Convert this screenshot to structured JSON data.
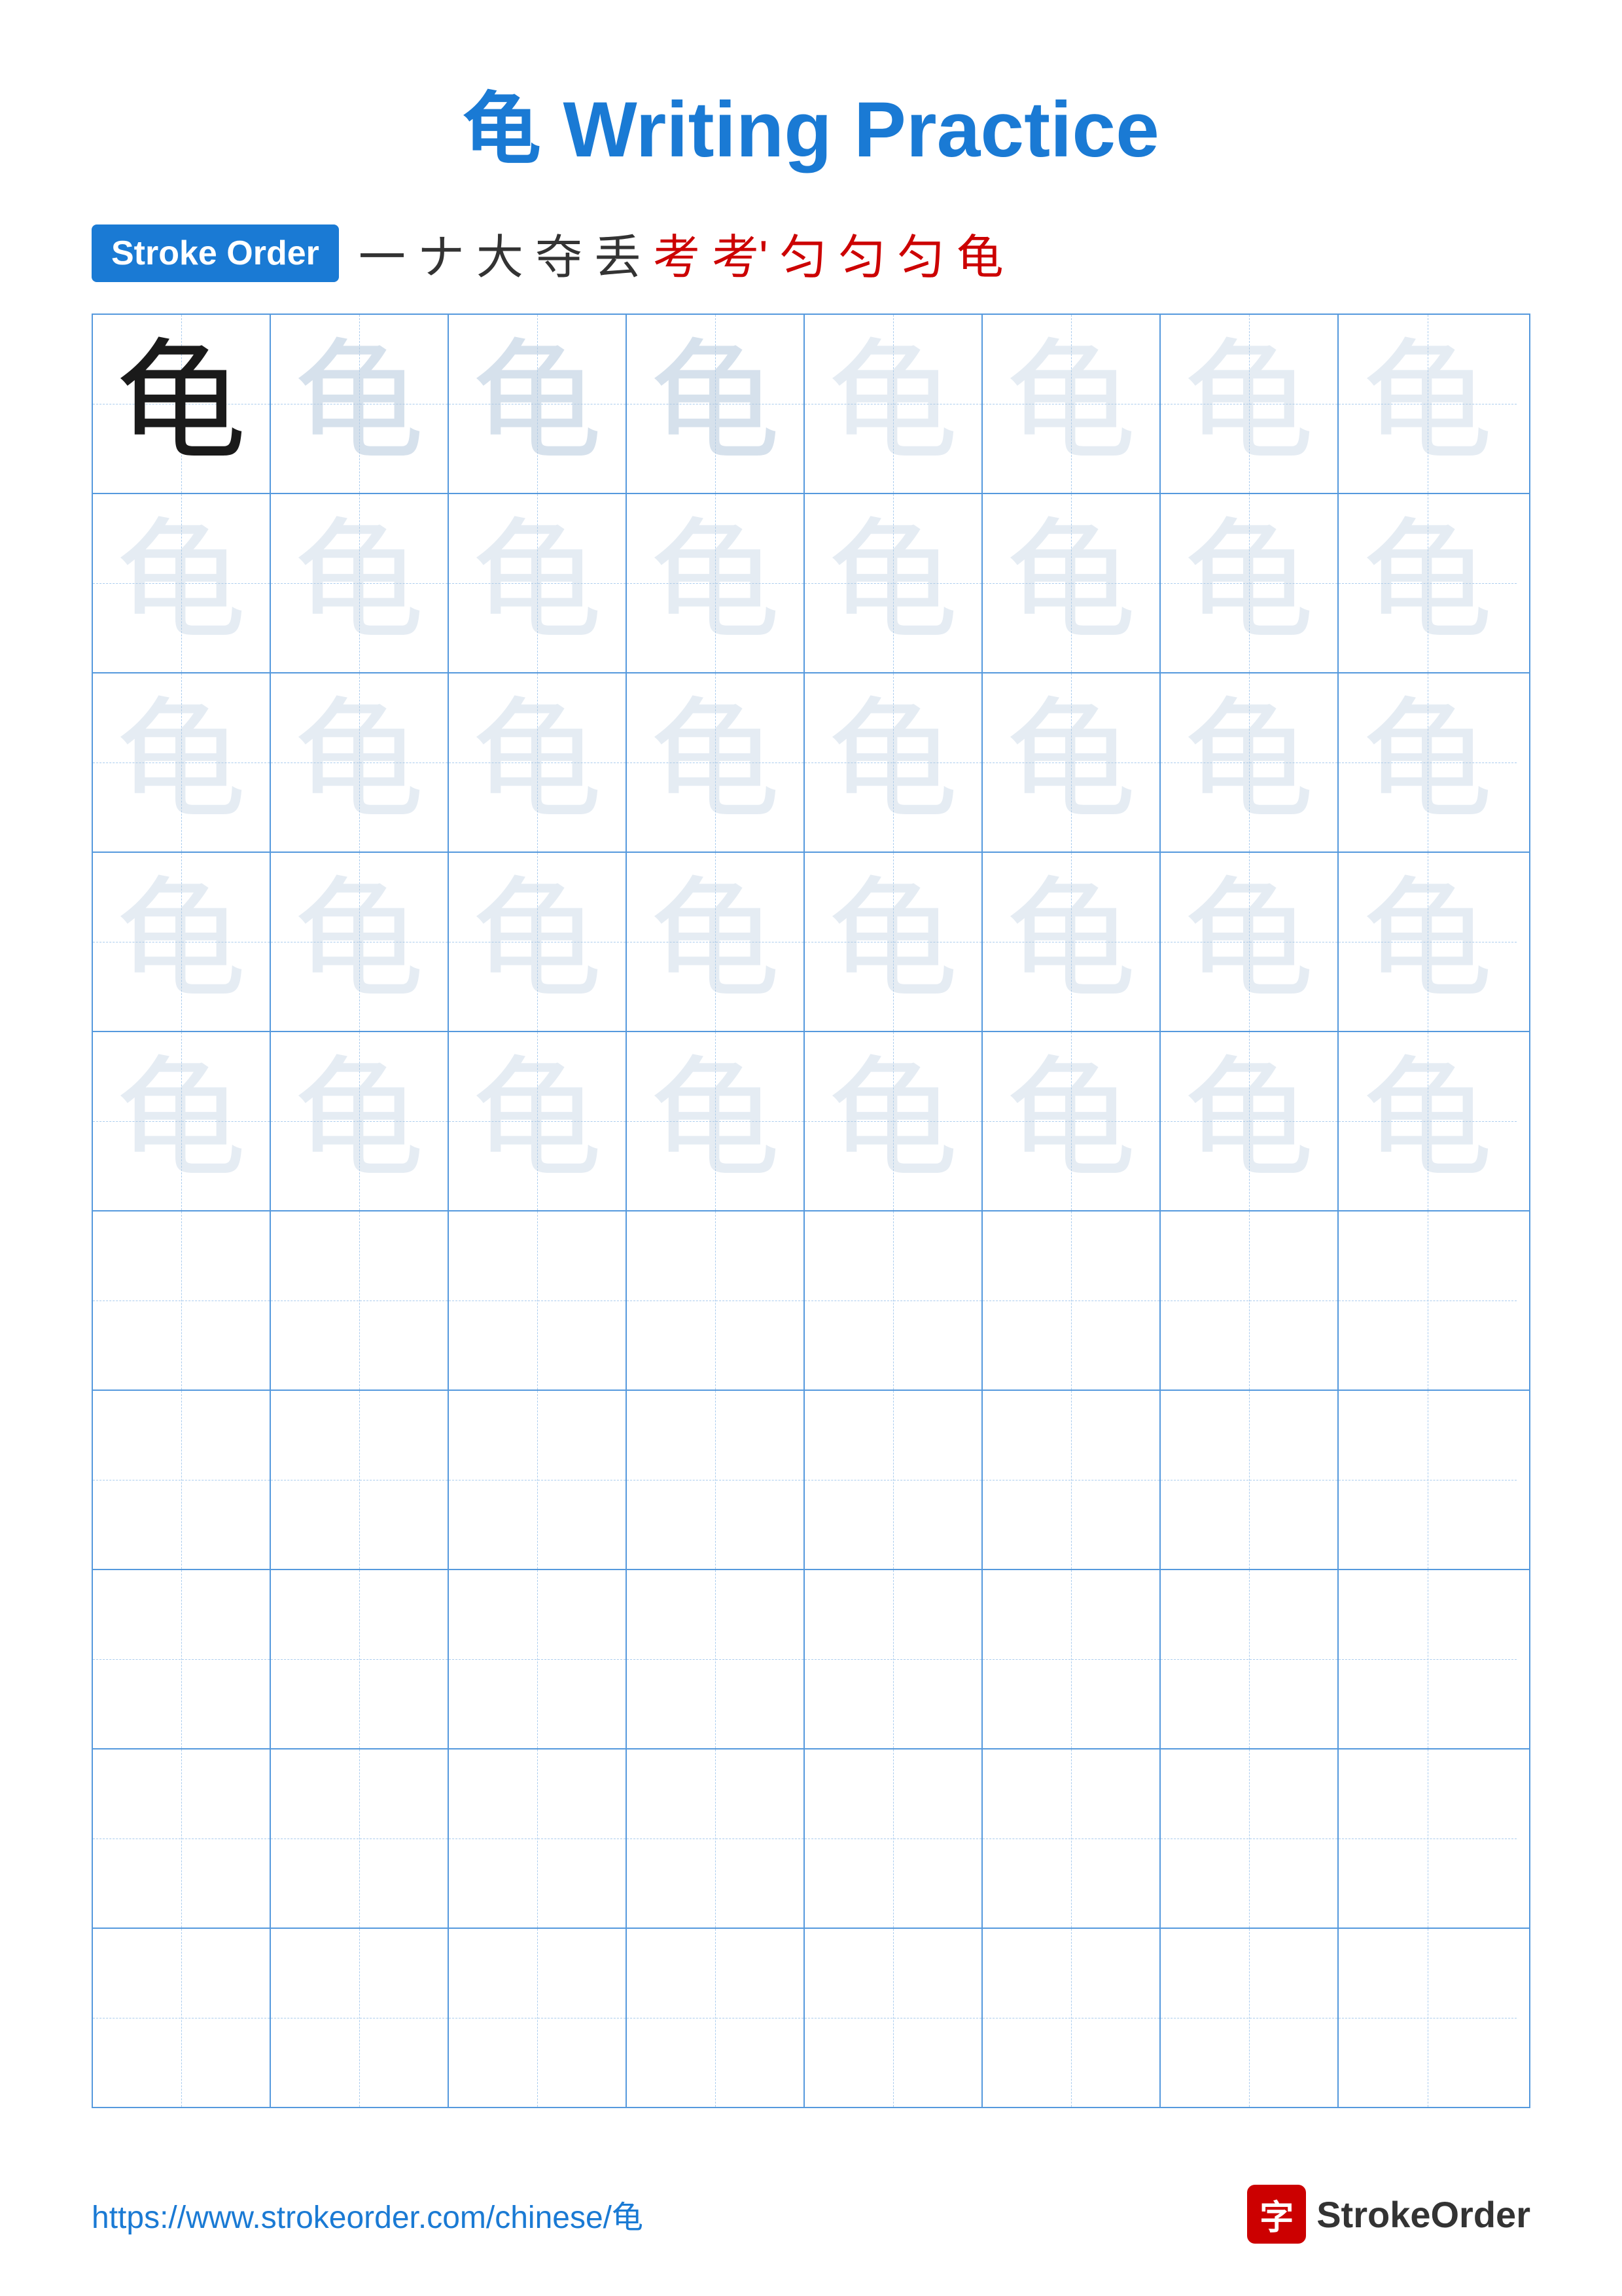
{
  "title": {
    "char": "龟",
    "text": "Writing Practice",
    "full": "龟 Writing Practice"
  },
  "stroke_order": {
    "badge_label": "Stroke Order",
    "strokes": [
      "一",
      "ナ",
      "大",
      "夺",
      "丢",
      "考",
      "考'",
      "匀",
      "匀",
      "匀",
      "龟"
    ]
  },
  "grid": {
    "rows": 10,
    "cols": 8,
    "char": "龟"
  },
  "footer": {
    "url": "https://www.strokeorder.com/chinese/龟",
    "logo_char": "字",
    "logo_text": "StrokeOrder"
  }
}
